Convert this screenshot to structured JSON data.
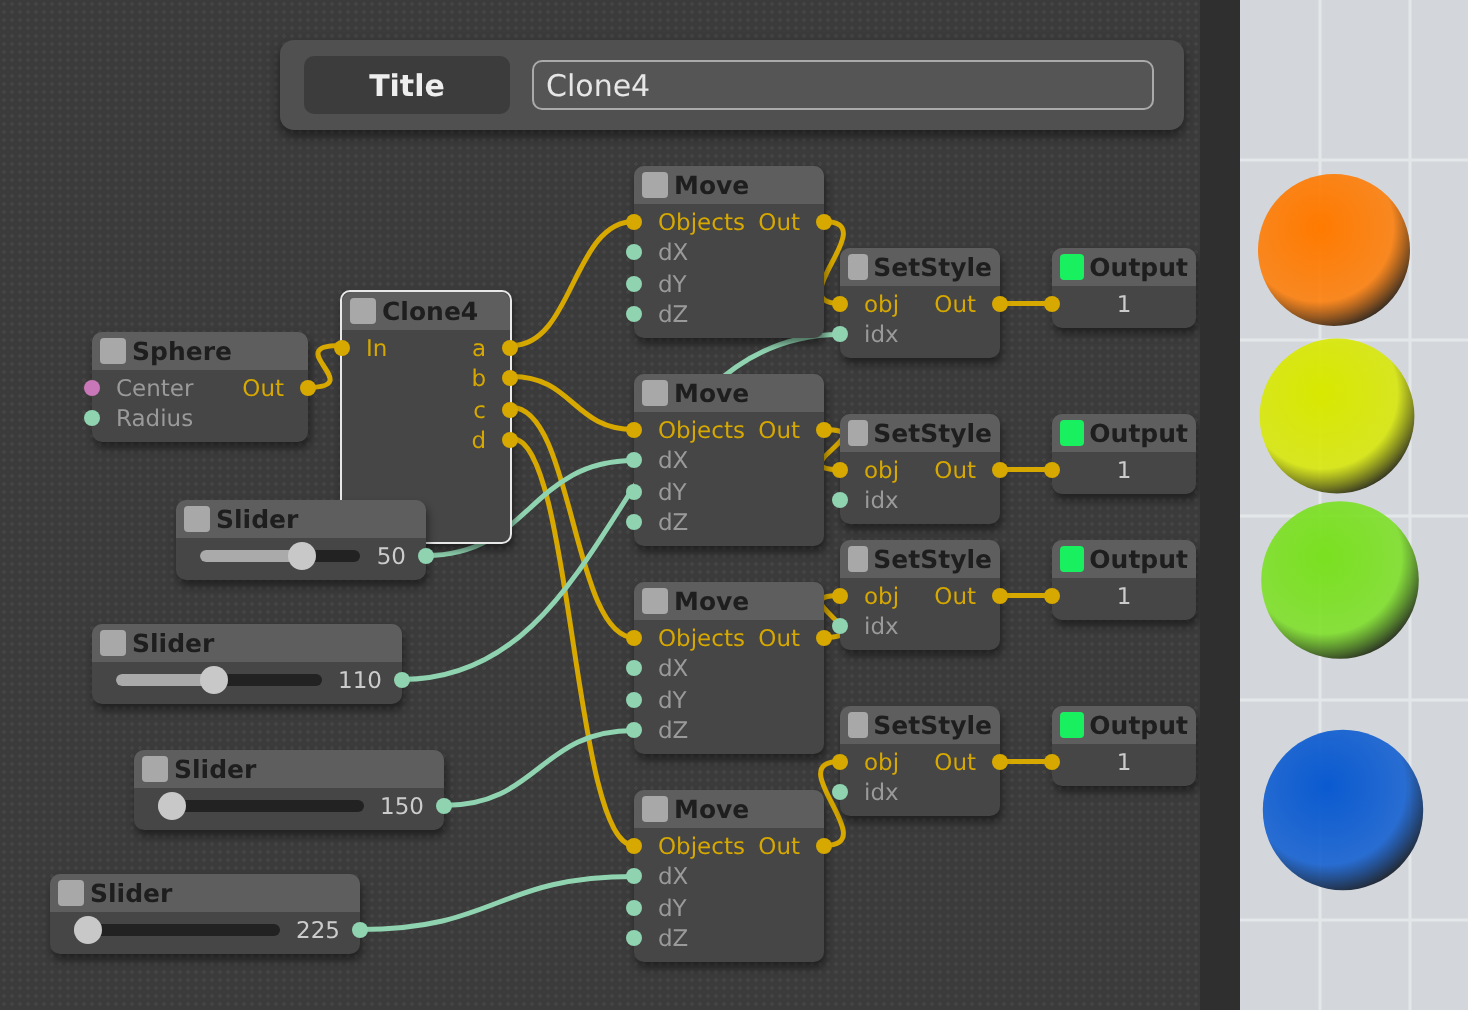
{
  "title_panel": {
    "button": "Title",
    "value": "Clone4"
  },
  "nodes": [
    {
      "kind": "node",
      "title": "Sphere",
      "checked": false,
      "selected": false,
      "inputs": [
        {
          "label": "Center",
          "kind": "point"
        },
        {
          "label": "Radius",
          "kind": "number"
        }
      ],
      "outputs": [
        {
          "label": "Out",
          "kind": "object"
        }
      ]
    },
    {
      "kind": "node",
      "title": "Clone4",
      "checked": false,
      "selected": true,
      "inputs": [
        {
          "label": "In",
          "kind": "object"
        }
      ],
      "outputs": [
        {
          "label": "a",
          "kind": "object"
        },
        {
          "label": "b",
          "kind": "object"
        },
        {
          "label": "c",
          "kind": "object"
        },
        {
          "label": "d",
          "kind": "object"
        }
      ]
    },
    {
      "kind": "slider",
      "title": "Slider",
      "checked": false,
      "selected": false,
      "level": 0.67,
      "value": "50"
    },
    {
      "kind": "slider",
      "title": "Slider",
      "checked": false,
      "selected": false,
      "level": 0.47,
      "value": "110"
    },
    {
      "kind": "slider",
      "title": "Slider",
      "checked": false,
      "selected": false,
      "level": 0,
      "value": "150"
    },
    {
      "kind": "slider",
      "title": "Slider",
      "checked": false,
      "selected": false,
      "level": 0,
      "value": "225"
    },
    {
      "kind": "node",
      "title": "Move",
      "checked": false,
      "selected": false,
      "inputs": [
        {
          "label": "Objects",
          "kind": "object"
        },
        {
          "label": "dX",
          "kind": "number"
        },
        {
          "label": "dY",
          "kind": "number"
        },
        {
          "label": "dZ",
          "kind": "number"
        }
      ],
      "outputs": [
        {
          "label": "Out",
          "kind": "object"
        }
      ]
    },
    {
      "kind": "node",
      "title": "Move",
      "checked": false,
      "selected": false,
      "inputs": [
        {
          "label": "Objects",
          "kind": "object"
        },
        {
          "label": "dX",
          "kind": "number"
        },
        {
          "label": "dY",
          "kind": "number"
        },
        {
          "label": "dZ",
          "kind": "number"
        }
      ],
      "outputs": [
        {
          "label": "Out",
          "kind": "object"
        }
      ]
    },
    {
      "kind": "node",
      "title": "Move",
      "checked": false,
      "selected": false,
      "inputs": [
        {
          "label": "Objects",
          "kind": "object"
        },
        {
          "label": "dX",
          "kind": "number"
        },
        {
          "label": "dY",
          "kind": "number"
        },
        {
          "label": "dZ",
          "kind": "number"
        }
      ],
      "outputs": [
        {
          "label": "Out",
          "kind": "object"
        }
      ]
    },
    {
      "kind": "node",
      "title": "Move",
      "checked": false,
      "selected": false,
      "inputs": [
        {
          "label": "Objects",
          "kind": "object"
        },
        {
          "label": "dX",
          "kind": "number"
        },
        {
          "label": "dY",
          "kind": "number"
        },
        {
          "label": "dZ",
          "kind": "number"
        }
      ],
      "outputs": [
        {
          "label": "Out",
          "kind": "object"
        }
      ]
    },
    {
      "kind": "node",
      "title": "SetStyle",
      "checked": false,
      "selected": false,
      "inputs": [
        {
          "label": "obj",
          "kind": "object"
        },
        {
          "label": "idx",
          "kind": "number"
        }
      ],
      "outputs": [
        {
          "label": "Out",
          "kind": "object"
        }
      ]
    },
    {
      "kind": "node",
      "title": "SetStyle",
      "checked": false,
      "selected": false,
      "inputs": [
        {
          "label": "obj",
          "kind": "object"
        },
        {
          "label": "idx",
          "kind": "number"
        }
      ],
      "outputs": [
        {
          "label": "Out",
          "kind": "object"
        }
      ]
    },
    {
      "kind": "node",
      "title": "SetStyle",
      "checked": false,
      "selected": false,
      "inputs": [
        {
          "label": "obj",
          "kind": "object"
        },
        {
          "label": "idx",
          "kind": "number"
        }
      ],
      "outputs": [
        {
          "label": "Out",
          "kind": "object"
        }
      ]
    },
    {
      "kind": "node",
      "title": "SetStyle",
      "checked": false,
      "selected": false,
      "inputs": [
        {
          "label": "obj",
          "kind": "object"
        },
        {
          "label": "idx",
          "kind": "number"
        }
      ],
      "outputs": [
        {
          "label": "Out",
          "kind": "object"
        }
      ]
    },
    {
      "kind": "output",
      "title": "Output",
      "checked": true,
      "selected": false,
      "value": "1"
    },
    {
      "kind": "output",
      "title": "Output",
      "checked": true,
      "selected": false,
      "value": "1"
    },
    {
      "kind": "output",
      "title": "Output",
      "checked": true,
      "selected": false,
      "value": "1"
    },
    {
      "kind": "output",
      "title": "Output",
      "checked": true,
      "selected": false,
      "value": "1"
    }
  ]
}
